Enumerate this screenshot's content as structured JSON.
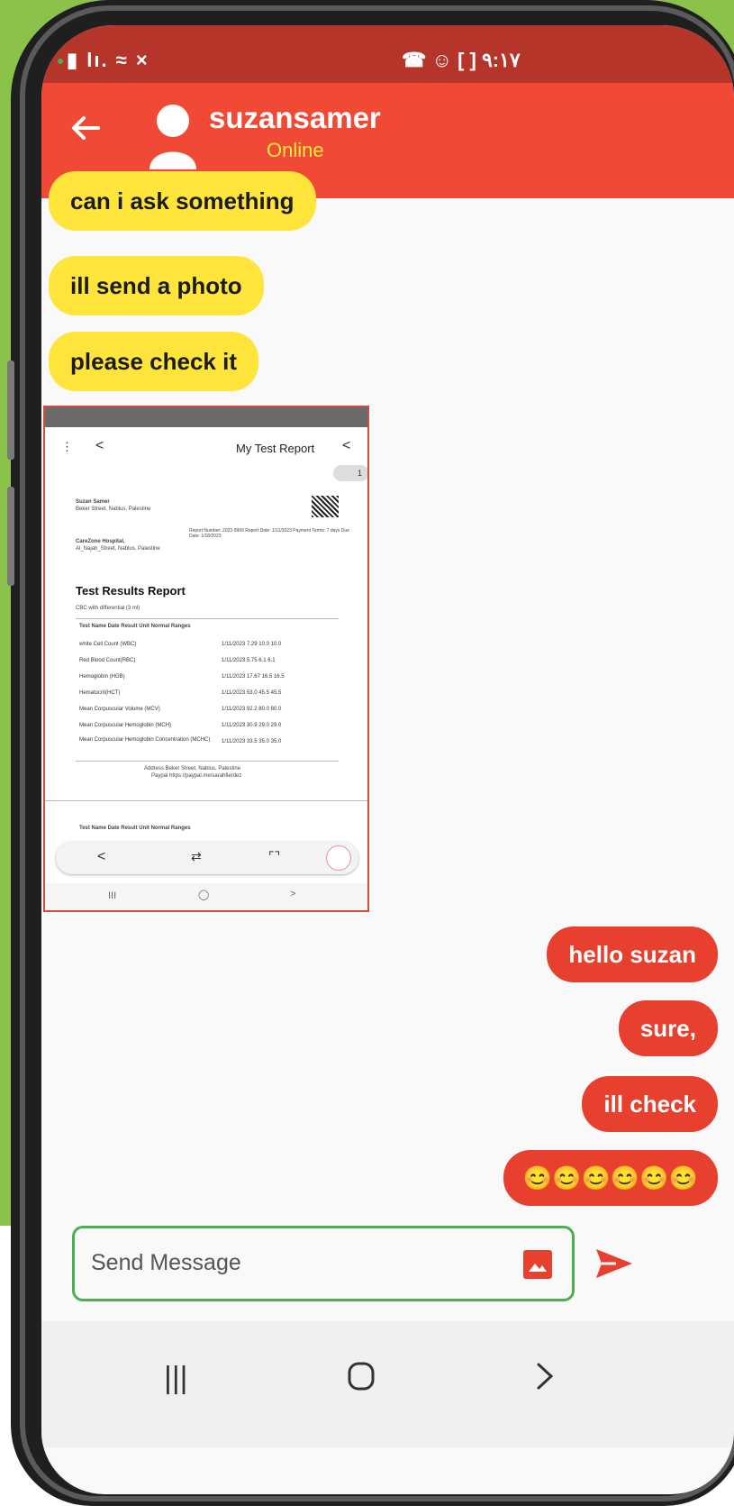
{
  "status_bar": {
    "left_icons": "▮ lı. ≈ ×",
    "right_icons": "☎ ☺ [ ] ٩:١٧"
  },
  "header": {
    "back_icon": "arrow-left-icon",
    "avatar_icon": "person-icon",
    "contact_name": "suzansamer",
    "contact_status": "Online"
  },
  "messages": {
    "incoming": [
      {
        "text": "can i ask something"
      },
      {
        "text": "ill send a photo"
      },
      {
        "text": "please check it"
      }
    ],
    "outgoing": [
      {
        "text": "hello suzan"
      },
      {
        "text": "sure,"
      },
      {
        "text": "ill check"
      },
      {
        "text": "😊😊😊😊😊😊"
      }
    ]
  },
  "photo": {
    "title": "My Test Report",
    "page_number": "1",
    "patient_name": "Suzan Samer",
    "patient_address": "Beker Street, Nablus, Palestine",
    "hospital_name": "CareZone Hospital,",
    "hospital_address": "Al_Najah_Street, Nablus, Palestine",
    "meta": "Report Number: 2023-9999  Report Date: 1/11/2023  Payment Terms: 7 days  Due Date: 1/18/2023",
    "report_heading": "Test Results Report",
    "report_subheading": "CBC with differential (3 ml)",
    "columns": "Test Name    Date    Result    Unit    Normal Ranges",
    "rows": [
      {
        "name": "white Cell Count (WBC)",
        "values": "1/11/2023   7.29   10.0   10.0"
      },
      {
        "name": "Red Blood Count(RBC)",
        "values": "1/11/2023   5.75   6.1   6.1"
      },
      {
        "name": "Hemoglobin (HGB)",
        "values": "1/11/2023   17.67   16.5   16.5"
      },
      {
        "name": "Hematocrit(HCT)",
        "values": "1/11/2023   53.0   45.5   45.5"
      },
      {
        "name": "Mean Corpuscular Volume (MCV)",
        "values": "1/11/2023   92.2   80.0   80.0"
      },
      {
        "name": "Mean Corpuscular Hemoglobin (MCH)",
        "values": "1/11/2023   30.9   29.0   29.0"
      },
      {
        "name": "Mean Corpuscular Hemoglobin Concentration (MCHC)",
        "values": "1/11/2023   33.5   35.0   35.0"
      }
    ],
    "footer_address": "Address  Beker Street, Nablus, Palestine",
    "footer_paypal": "Paypal  https://paypal.me/sarahfierdez",
    "columns_2": "Test Name    Date    Result    Unit    Normal Ranges"
  },
  "composer": {
    "placeholder": "Send Message",
    "image_icon": "image-icon",
    "send_icon": "send-icon"
  },
  "colors": {
    "appbar": "#f04a36",
    "statusbar": "#b5352a",
    "incoming_bubble": "#ffe43b",
    "outgoing_bubble": "#e8402e",
    "online": "#ffeb3b",
    "input_border": "#4caf50",
    "background": "#8bc34a"
  }
}
